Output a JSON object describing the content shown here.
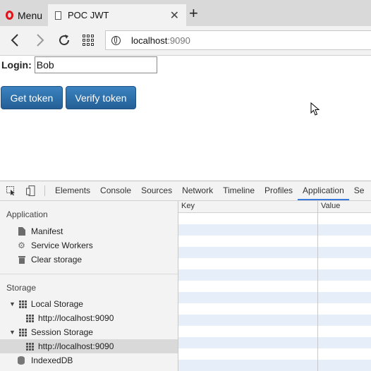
{
  "browser": {
    "menu_label": "Menu",
    "tab_title": "POC JWT",
    "tab_close": "✕",
    "new_tab": "+",
    "url_host": "localhost",
    "url_port": ":9090"
  },
  "page": {
    "login_label": "Login:",
    "login_value": "Bob",
    "get_token_label": "Get token",
    "verify_token_label": "Verify token"
  },
  "devtools": {
    "tabs": [
      "Elements",
      "Console",
      "Sources",
      "Network",
      "Timeline",
      "Profiles",
      "Application",
      "Se"
    ],
    "active_tab": "Application",
    "sidebar": {
      "application_title": "Application",
      "manifest": "Manifest",
      "service_workers": "Service Workers",
      "clear_storage": "Clear storage",
      "storage_title": "Storage",
      "local_storage": "Local Storage",
      "local_storage_origin": "http://localhost:9090",
      "session_storage": "Session Storage",
      "session_storage_origin": "http://localhost:9090",
      "indexeddb": "IndexedDB"
    },
    "table": {
      "key_header": "Key",
      "value_header": "Value"
    }
  },
  "colors": {
    "button_blue": "#2f72ad",
    "active_tab_underline": "#3879d9",
    "row_stripe": "#e6eefa",
    "opera_red": "#e0151b"
  }
}
